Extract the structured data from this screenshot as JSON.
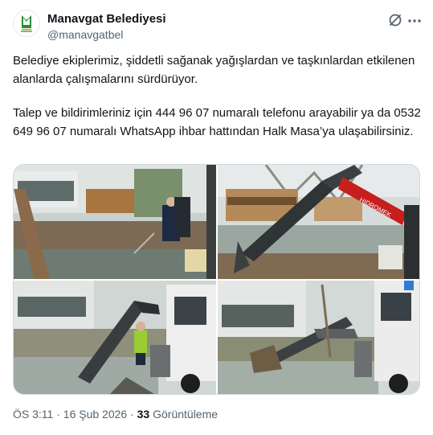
{
  "account": {
    "name": "Manavgat Belediyesi",
    "handle": "@manavgatbel",
    "avatar_icon": "manavgat-belediyesi-logo"
  },
  "actions": {
    "grok_icon": "grok-slash-icon",
    "more_icon": "more-dots-icon"
  },
  "tweet": {
    "paragraph1": "Belediye ekiplerimiz, şiddetli sağanak yağışlardan ve taşkınlardan etkilenen alanlarda çalışmalarını sürdürüyor.",
    "paragraph2": "Talep ve bildirimleriniz için 444 96 07 numaralı telefonu arayabilir ya da 0532 649 96 07 numaralı WhatsApp ihbar hattından Halk Masa’ya ulaşabilirsiniz."
  },
  "media": {
    "photo_count": 4,
    "machine_brand": "HIDROMEK"
  },
  "meta": {
    "time": "ÖS 3:11",
    "separator": "·",
    "date": "16 Şub 2026",
    "views_count": "33",
    "views_label": "Görüntüleme"
  },
  "colors": {
    "text": "#0f1419",
    "secondary": "#536471",
    "border": "#cfd9de",
    "logo_green": "#2e8b3a"
  }
}
